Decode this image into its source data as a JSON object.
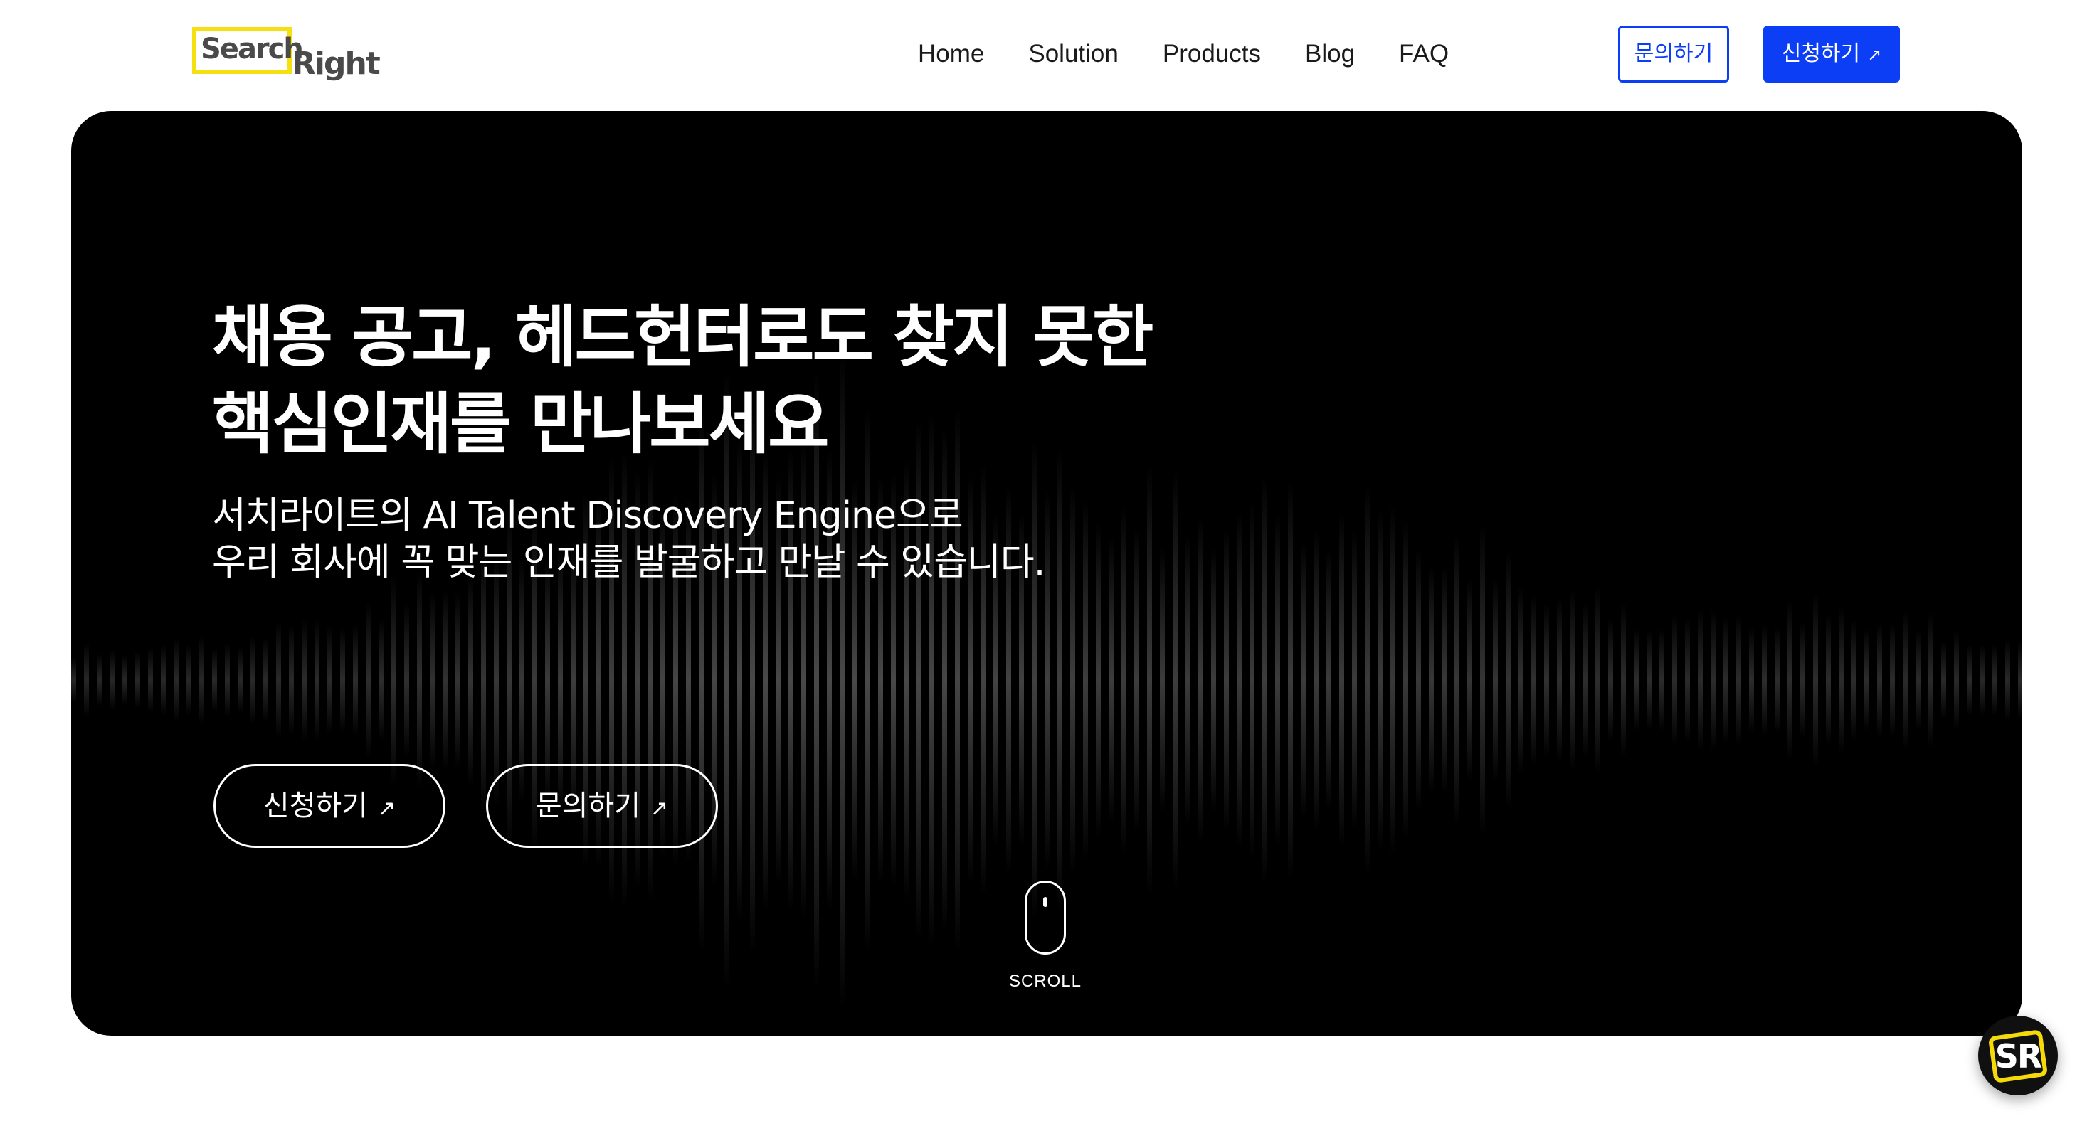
{
  "logo": {
    "word1": "Search",
    "word2": "Right",
    "accent": "#f5e112"
  },
  "nav": {
    "items": [
      {
        "label": "Home"
      },
      {
        "label": "Solution"
      },
      {
        "label": "Products"
      },
      {
        "label": "Blog"
      },
      {
        "label": "FAQ"
      }
    ],
    "inquiry_label": "문의하기",
    "apply_label": "신청하기",
    "arrow": "↗"
  },
  "hero": {
    "title_line1": "채용 공고, 헤드헌터로도 찾지 못한",
    "title_line2": "핵심인재를 만나보세요",
    "subtitle_line1": "서치라이트의 AI Talent Discovery Engine으로",
    "subtitle_line2": "우리 회사에 꼭 맞는 인재를 발굴하고 만날 수 있습니다.",
    "cta_apply": "신청하기",
    "cta_inquiry": "문의하기",
    "arrow": "↗",
    "scroll_label": "SCROLL"
  },
  "badge": {
    "text": "SR",
    "accent": "#f5d90a"
  },
  "colors": {
    "primary": "#0b3ef5",
    "hero_bg": "#000000"
  }
}
